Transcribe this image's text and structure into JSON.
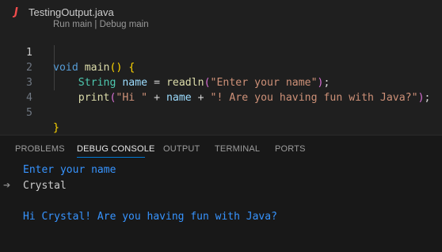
{
  "editor": {
    "tab_icon": "J",
    "file_name": "TestingOutput.java",
    "codelens": {
      "run": "Run main",
      "separator": " | ",
      "debug": "Debug main"
    },
    "lines": [
      {
        "number": "1",
        "active": true
      },
      {
        "number": "2"
      },
      {
        "number": "3"
      },
      {
        "number": "4"
      },
      {
        "number": "5"
      }
    ],
    "code": {
      "l1_kw": "void",
      "l1_fn": "main",
      "l1_open": "(",
      "l1_close": ")",
      "l1_brace": "{",
      "l2_type": "String",
      "l2_var": "name",
      "l2_eq": " = ",
      "l2_fn": "readln",
      "l2_open": "(",
      "l2_str": "\"Enter your name\"",
      "l2_close": ")",
      "l2_semi": ";",
      "l3_fn": "print",
      "l3_open": "(",
      "l3_str1": "\"Hi \"",
      "l3_plus1": " + ",
      "l3_var": "name",
      "l3_plus2": " + ",
      "l3_str2": "\"! Are you having fun with Java?\"",
      "l3_close": ")",
      "l3_semi": ";",
      "l5_brace": "}"
    }
  },
  "panel": {
    "tabs": [
      "PROBLEMS",
      "DEBUG CONSOLE",
      "OUTPUT",
      "TERMINAL",
      "PORTS"
    ],
    "active_tab": "DEBUG CONSOLE",
    "console": {
      "prompt": "Enter your name",
      "input_icon": "arrow-right-icon",
      "input": "Crystal",
      "output": "Hi Crystal! Are you having fun with Java?"
    }
  },
  "colors": {
    "background": "#1f1f1f",
    "panel": "#181818",
    "accent": "#0078d4",
    "console_blue": "#3794ff"
  }
}
